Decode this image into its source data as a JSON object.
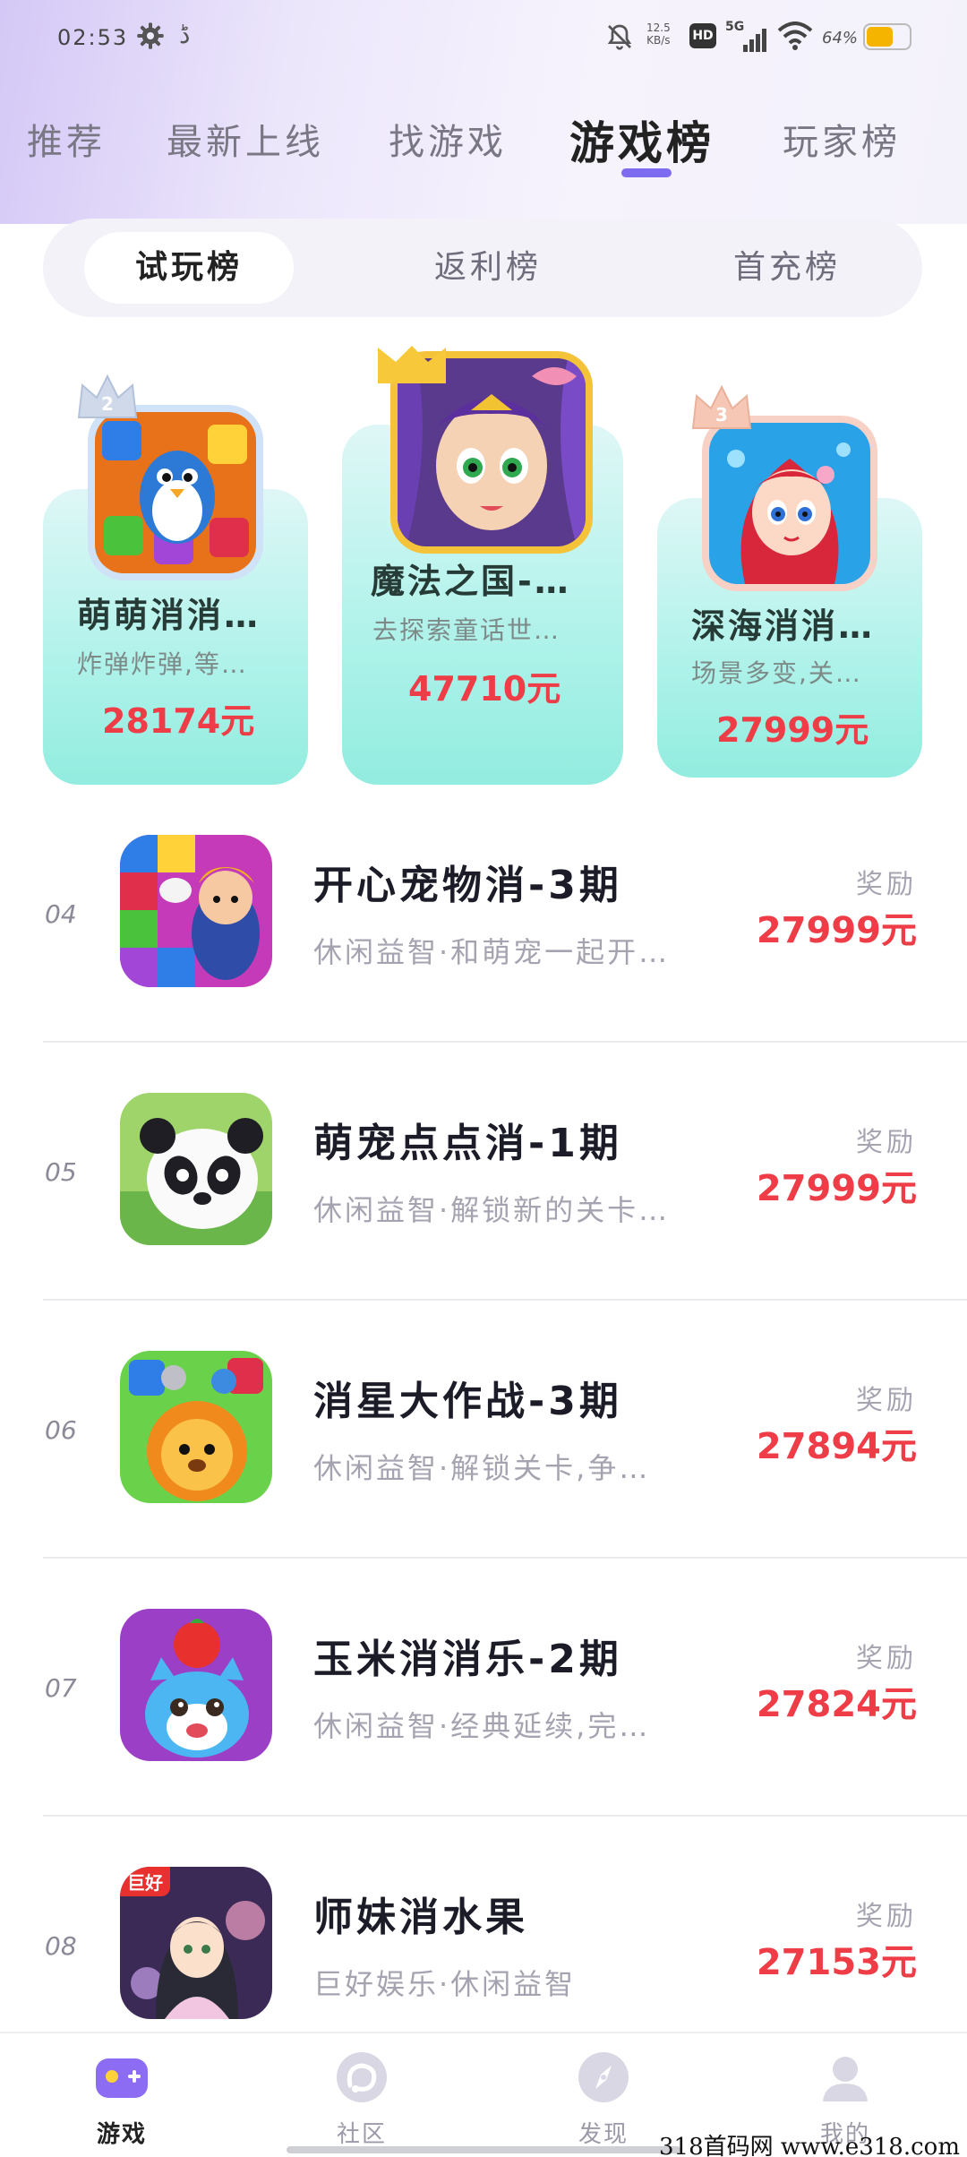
{
  "status_bar": {
    "time": "02:53",
    "extra_glyph": "ڈ",
    "net_speed": "12.5",
    "net_speed_unit": "KB/s",
    "hd": "HD",
    "signal": "5G",
    "battery_pct": "64%",
    "battery_level": 0.64,
    "battery_color": "#f5b400"
  },
  "main_tabs": [
    {
      "label": "推荐",
      "active": false
    },
    {
      "label": "最新上线",
      "active": false
    },
    {
      "label": "找游戏",
      "active": false
    },
    {
      "label": "游戏榜",
      "active": true
    },
    {
      "label": "玩家榜",
      "active": false
    }
  ],
  "segment_tabs": [
    {
      "label": "试玩榜",
      "active": true
    },
    {
      "label": "返利榜",
      "active": false
    },
    {
      "label": "首充榜",
      "active": false
    }
  ],
  "podium": [
    {
      "rank": "2",
      "title": "萌萌消消…",
      "desc": "炸弹炸弹,等…",
      "prize": "28174元",
      "icon": "penguin-game-icon"
    },
    {
      "rank": "1",
      "title": "魔法之国-…",
      "desc": "去探索童话世…",
      "prize": "47710元",
      "icon": "fairy-game-icon"
    },
    {
      "rank": "3",
      "title": "深海消消…",
      "desc": "场景多变,关…",
      "prize": "27999元",
      "icon": "mermaid-game-icon"
    }
  ],
  "reward_label": "奖励",
  "list": [
    {
      "rank": "04",
      "title": "开心宠物消-3期",
      "desc": "休闲益智·和萌宠一起开…",
      "reward": "27999元",
      "icon": "pet-game-icon"
    },
    {
      "rank": "05",
      "title": "萌宠点点消-1期",
      "desc": "休闲益智·解锁新的关卡…",
      "reward": "27999元",
      "icon": "panda-game-icon"
    },
    {
      "rank": "06",
      "title": "消星大作战-3期",
      "desc": "休闲益智·解锁关卡,争…",
      "reward": "27894元",
      "icon": "lion-game-icon"
    },
    {
      "rank": "07",
      "title": "玉米消消乐-2期",
      "desc": "休闲益智·经典延续,完…",
      "reward": "27824元",
      "icon": "cat-game-icon"
    },
    {
      "rank": "08",
      "title": "师妹消水果",
      "desc": "巨好娱乐·休闲益智",
      "reward": "27153元",
      "icon": "girl-game-icon",
      "icon_badge": "巨好"
    }
  ],
  "bottom_nav": [
    {
      "label": "游戏",
      "active": true,
      "icon": "gamepad-icon"
    },
    {
      "label": "社区",
      "active": false,
      "icon": "community-icon"
    },
    {
      "label": "发现",
      "active": false,
      "icon": "compass-icon"
    },
    {
      "label": "我的",
      "active": false,
      "icon": "profile-icon"
    }
  ],
  "watermark": "318首码网  www.e318.com",
  "colors": {
    "accent": "#7d6bf0",
    "prize_red": "#ee3d47",
    "card_teal": "#aef2ea"
  }
}
